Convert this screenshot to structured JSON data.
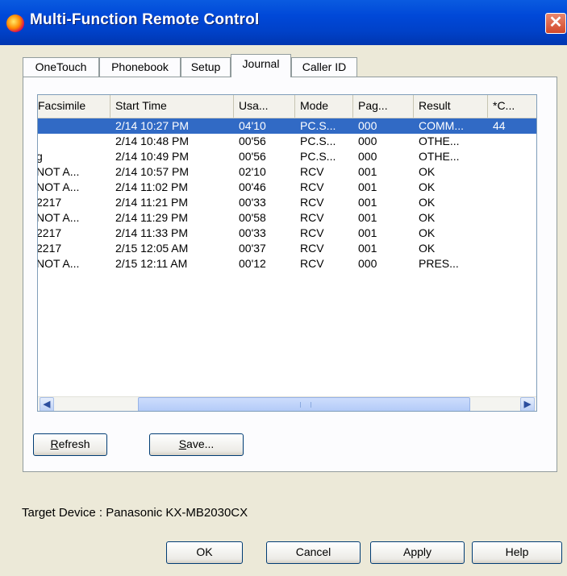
{
  "window": {
    "title": "Multi-Function Remote Control",
    "close_glyph": "✕"
  },
  "tabs": [
    {
      "label": "OneTouch",
      "active": false
    },
    {
      "label": "Phonebook",
      "active": false
    },
    {
      "label": "Setup",
      "active": false
    },
    {
      "label": "Journal",
      "active": true
    },
    {
      "label": "Caller ID",
      "active": false
    }
  ],
  "journal": {
    "columns": [
      "Facsimile",
      "Start Time",
      "Usa...",
      "Mode",
      "Pag...",
      "Result",
      "*C..."
    ],
    "rows": [
      {
        "facsimile": "",
        "start": "2/14 10:27 PM",
        "usage": "04'10",
        "mode": "PC.S...",
        "pages": "000",
        "result": "COMM...",
        "code": "44",
        "selected": true
      },
      {
        "facsimile": "",
        "start": "2/14 10:48 PM",
        "usage": "00'56",
        "mode": "PC.S...",
        "pages": "000",
        "result": "OTHE...",
        "code": ""
      },
      {
        "facsimile": "g",
        "start": "2/14 10:49 PM",
        "usage": "00'56",
        "mode": "PC.S...",
        "pages": "000",
        "result": "OTHE...",
        "code": ""
      },
      {
        "facsimile": "NOT A...",
        "start": "2/14 10:57 PM",
        "usage": "02'10",
        "mode": "RCV",
        "pages": "001",
        "result": "OK",
        "code": ""
      },
      {
        "facsimile": "NOT A...",
        "start": "2/14 11:02 PM",
        "usage": "00'46",
        "mode": "RCV",
        "pages": "001",
        "result": "OK",
        "code": ""
      },
      {
        "facsimile": "2217",
        "start": "2/14 11:21 PM",
        "usage": "00'33",
        "mode": "RCV",
        "pages": "001",
        "result": "OK",
        "code": ""
      },
      {
        "facsimile": "NOT A...",
        "start": "2/14 11:29 PM",
        "usage": "00'58",
        "mode": "RCV",
        "pages": "001",
        "result": "OK",
        "code": ""
      },
      {
        "facsimile": "2217",
        "start": "2/14 11:33 PM",
        "usage": "00'33",
        "mode": "RCV",
        "pages": "001",
        "result": "OK",
        "code": ""
      },
      {
        "facsimile": "2217",
        "start": "2/15 12:05 AM",
        "usage": "00'37",
        "mode": "RCV",
        "pages": "001",
        "result": "OK",
        "code": ""
      },
      {
        "facsimile": "NOT A...",
        "start": "2/15 12:11 AM",
        "usage": "00'12",
        "mode": "RCV",
        "pages": "000",
        "result": "PRES...",
        "code": ""
      }
    ],
    "scroll_left_glyph": "◀",
    "scroll_right_glyph": "▶"
  },
  "buttons": {
    "refresh_accel": "R",
    "refresh_rest": "efresh",
    "save_accel": "S",
    "save_rest": "ave...",
    "ok": "OK",
    "cancel": "Cancel",
    "apply": "Apply",
    "help": "Help"
  },
  "target_device": "Target Device : Panasonic KX-MB2030CX"
}
